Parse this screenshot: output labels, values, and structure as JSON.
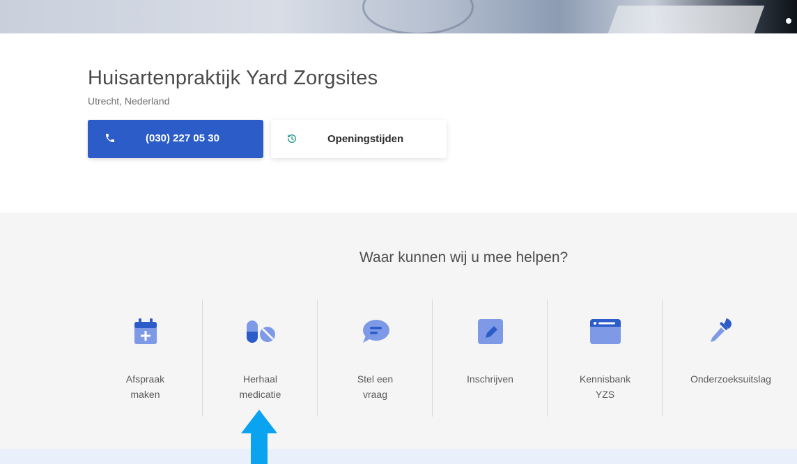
{
  "practice": {
    "name": "Huisartenpraktijk Yard Zorgsites",
    "location": "Utrecht, Nederland"
  },
  "buttons": {
    "phone_label": "(030) 227 05 30",
    "hours_label": "Openingstijden"
  },
  "help": {
    "heading": "Waar kunnen wij u mee helpen?",
    "services": [
      {
        "label": "Afspraak maken",
        "icon": "calendar-plus-icon"
      },
      {
        "label": "Herhaal medicatie",
        "icon": "pills-icon"
      },
      {
        "label": "Stel een vraag",
        "icon": "chat-bubble-icon"
      },
      {
        "label": "Inschrijven",
        "icon": "pencil-square-icon"
      },
      {
        "label": "Kennisbank YZS",
        "icon": "card-icon"
      },
      {
        "label": "Onderzoeksuitslag",
        "icon": "pipette-icon"
      }
    ]
  },
  "colors": {
    "primary": "#2b5cc8",
    "icon_fill": "#7e9ae6",
    "icon_dark": "#2b5cc8",
    "section_bg": "#f5f5f5",
    "arrow": "#0aa3f0"
  }
}
